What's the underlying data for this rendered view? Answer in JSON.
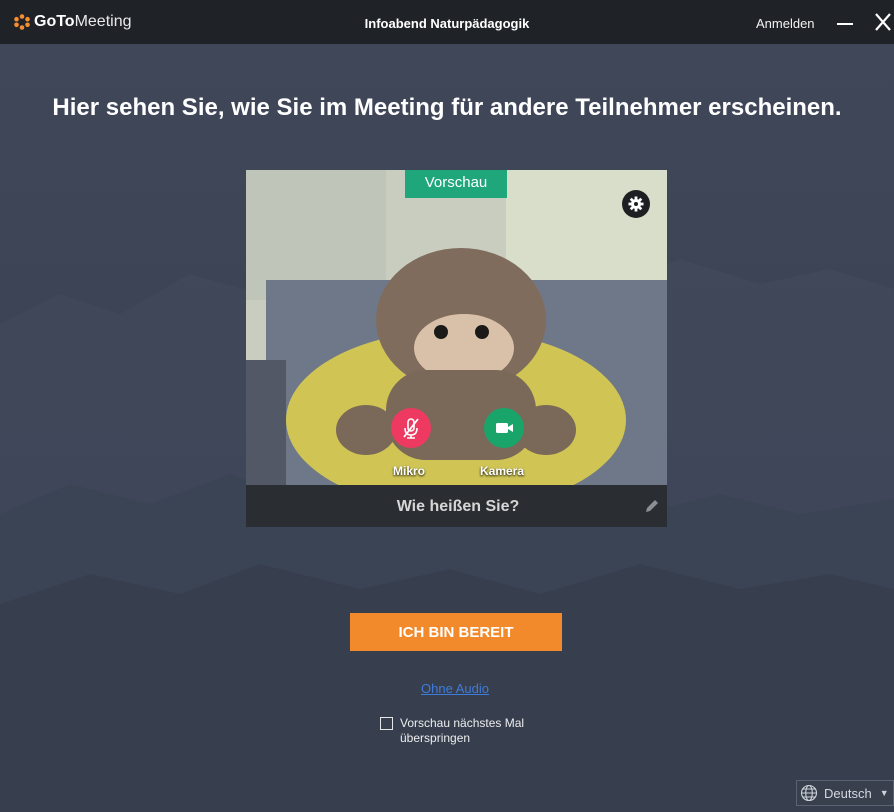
{
  "titlebar": {
    "logo_bold": "GoTo",
    "logo_light": "Meeting",
    "window_title": "Infoabend Naturpädagogik",
    "signin_label": "Anmelden"
  },
  "main": {
    "headline": "Hier sehen Sie, wie Sie im Meeting für andere Teilnehmer erscheinen.",
    "preview": {
      "badge": "Vorschau",
      "mic_label": "Mikro",
      "camera_label": "Kamera",
      "name_placeholder": "Wie heißen Sie?",
      "icons": [
        "gear-icon",
        "mic-muted-icon",
        "camera-icon",
        "pencil-icon"
      ]
    },
    "ready_label": "ICH BIN BEREIT",
    "no_audio_link": "Ohne Audio",
    "skip_preview_label": "Vorschau nächstes Mal überspringen",
    "skip_preview_checked": false
  },
  "footer": {
    "language": "Deutsch"
  },
  "colors": {
    "accent_orange": "#f28a2c",
    "badge_green": "#1fa77b",
    "mic_red": "#ee3a60",
    "camera_green": "#19a56a",
    "link_blue": "#3f7bd8",
    "background": "#3d4556"
  }
}
